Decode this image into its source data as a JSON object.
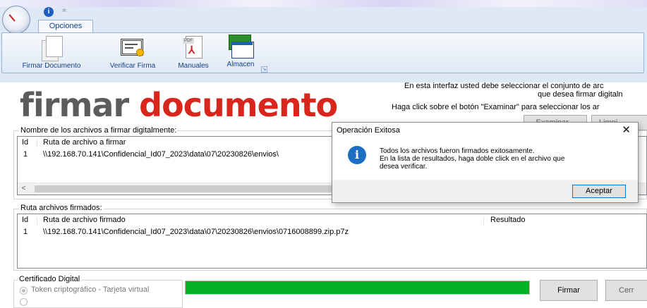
{
  "window": {
    "quick_access": {
      "help_glyph": "i",
      "dropdown_glyph": "="
    }
  },
  "ribbon": {
    "tab": "Opciones",
    "buttons": [
      {
        "label": "Firmar Documento",
        "icon": "document-stack-icon"
      },
      {
        "label": "Verificar Firma",
        "icon": "certificate-icon"
      },
      {
        "label": "Manuales",
        "icon": "pdf-icon"
      },
      {
        "label": "Almacen",
        "icon": "certificate-store-icon"
      }
    ],
    "launcher_glyph": "↘"
  },
  "header": {
    "brand_part1": "firmar",
    "brand_part2": "documento",
    "instruction_1a": "En esta interfaz usted debe seleccionar el conjunto de arc",
    "instruction_1b": "que  desea firmar digitaln",
    "instruction_2": "Haga click sobre el botón \"Examinar\" para seleccionar los ar",
    "examinar_label": "Examinar...",
    "limpiar_label": "Limpi"
  },
  "files_group": {
    "title": "Nombre de los archivos a firmar digitalmente:",
    "columns": [
      "Id",
      "Ruta de archivo a firmar"
    ],
    "rows": [
      {
        "id": "1",
        "path": "\\\\192.168.70.141\\Confidencial_Id07_2023\\data\\07\\20230826\\envios\\"
      }
    ],
    "scroll_left_glyph": "<"
  },
  "signed_group": {
    "title": "Ruta archivos firmados:",
    "columns": [
      "Id",
      "Ruta de archivo firmado",
      "Resultado"
    ],
    "rows": [
      {
        "id": "1",
        "path": "\\\\192.168.70.141\\Confidencial_Id07_2023\\data\\07\\20230826\\envios\\0716008899.zip.p7z",
        "result": ""
      }
    ]
  },
  "certificate_group": {
    "title": "Certificado Digital",
    "options": [
      {
        "label": "Token criptográfico - Tarjeta virtual",
        "selected": true
      }
    ]
  },
  "progress": {
    "value_percent": 100,
    "color": "#06b025"
  },
  "actions": {
    "firmar_label": "Firmar",
    "cerrar_label": "Cerr"
  },
  "dialog": {
    "title": "Operación Exitosa",
    "close_glyph": "✕",
    "icon": "information-icon",
    "icon_glyph": "i",
    "message": "Todos los archivos fueron firmados exitosamente.\nEn la lista de resultados, haga doble click en el archivo que\ndesea verificar.",
    "ok_label": "Aceptar"
  },
  "colors": {
    "brand_gray": "#5c5c5c",
    "brand_red": "#d8261c",
    "ribbon_blue": "#dfe9f5",
    "info_blue": "#1b6ec2"
  }
}
